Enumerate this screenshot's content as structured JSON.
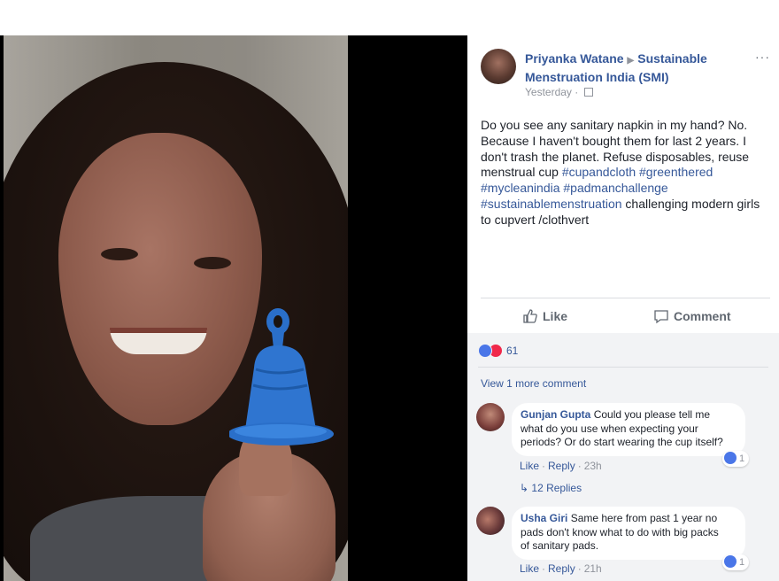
{
  "post": {
    "author": "Priyanka Watane",
    "group": "Sustainable Menstruation India (SMI)",
    "timestamp": "Yesterday",
    "more": "···",
    "text_lines": [
      {
        "segments": [
          {
            "t": "Do you see any sanitary napkin in my hand? No.",
            "tag": false
          }
        ]
      },
      {
        "segments": [
          {
            "t": "Because I haven't bought them for last 2 years. I",
            "tag": false
          }
        ]
      },
      {
        "segments": [
          {
            "t": "don't trash the planet. Refuse disposables, reuse",
            "tag": false
          }
        ]
      },
      {
        "segments": [
          {
            "t": "menstrual cup ",
            "tag": false
          },
          {
            "t": "#cupandcloth",
            "tag": true
          },
          {
            "t": " ",
            "tag": false
          },
          {
            "t": "#greenthered",
            "tag": true
          }
        ]
      },
      {
        "segments": [
          {
            "t": "#mycleanindia",
            "tag": true
          },
          {
            "t": " ",
            "tag": false
          },
          {
            "t": "#padmanchallenge",
            "tag": true
          }
        ]
      },
      {
        "segments": [
          {
            "t": "#sustainablemenstruation",
            "tag": true
          },
          {
            "t": " challenging modern girls",
            "tag": false
          }
        ]
      },
      {
        "segments": [
          {
            "t": "to cupvert /clothvert",
            "tag": false
          }
        ]
      }
    ]
  },
  "actions": {
    "like": "Like",
    "comment": "Comment"
  },
  "reactions": {
    "count": "61"
  },
  "view_more": "View 1 more comment",
  "comments": [
    {
      "name": "Gunjan Gupta",
      "text_lines": [
        "Could you please tell me",
        "what do you use when expecting your",
        "periods? Or do start wearing the cup itself?"
      ],
      "like": "Like",
      "reply": "Reply",
      "time": "23h",
      "reaction_count": "1",
      "replies": "12 Replies"
    },
    {
      "name": "Usha Giri",
      "text_lines": [
        "Same here from past 1 year no",
        "pads don't know what to do with big packs",
        "of sanitary pads."
      ],
      "like": "Like",
      "reply": "Reply",
      "time": "21h",
      "reaction_count": "1"
    }
  ],
  "colors": {
    "link": "#365899",
    "text": "#1d2129",
    "muted": "#90949c",
    "like_blue": "#4a76e8",
    "love_red": "#f0284a"
  }
}
